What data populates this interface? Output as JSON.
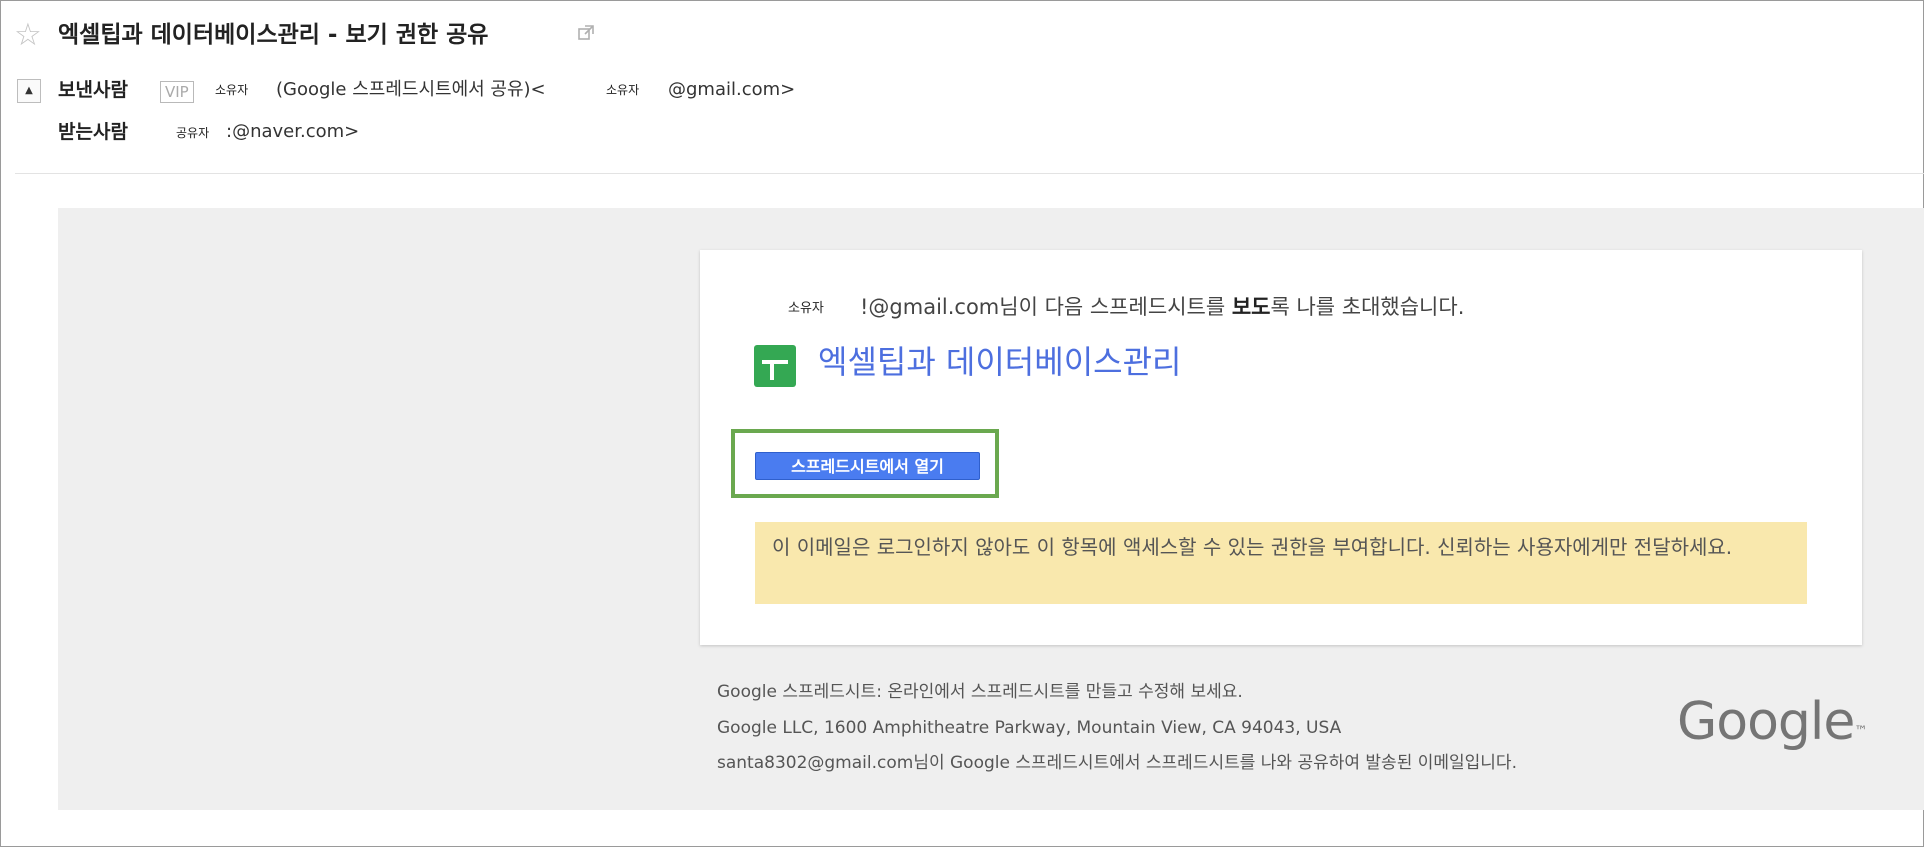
{
  "email": {
    "subject": "엑셀팁과 데이터베이스관리 - 보기 권한 공유",
    "from_label": "보낸사람",
    "vip_badge": "VIP",
    "from_owner_tag": "소유자",
    "from_sender_text": "(Google 스프레드시트에서 공유)<",
    "from_owner_tag_2": "소유자",
    "from_email_suffix": "@gmail.com>",
    "to_label": "받는사람",
    "to_share_tag": "공유자",
    "to_email_suffix": ":@naver.com>"
  },
  "body": {
    "owner_tag": "소유자",
    "invite_email": "!@gmail.com",
    "invite_text_1": "님이 다음 스프레드시트를 ",
    "invite_text_bold": "보도",
    "invite_text_2": "록 나를 초대했습니다.",
    "document_title": "엑셀팁과 데이터베이스관리",
    "open_button": "스프레드시트에서 열기",
    "warning": "이 이메일은 로그인하지 않아도 이 항목에 액세스할 수 있는 권한을 부여합니다. 신뢰하는 사용자에게만 전달하세요."
  },
  "footer": {
    "line1": "Google 스프레드시트: 온라인에서 스프레드시트를 만들고 수정해 보세요.",
    "line2": "Google LLC, 1600 Amphitheatre Parkway, Mountain View, CA 94043, USA",
    "line3": "santa8302@gmail.com님이 Google 스프레드시트에서 스프레드시트를 나와 공유하여 발송된 이메일입니다.",
    "logo": "Google",
    "logo_tm": "™"
  },
  "colors": {
    "link": "#4d6fdf",
    "button": "#4a7cf0",
    "highlight_border": "#6aa84f",
    "warning_bg": "#f9e8ad",
    "sheets_green": "#34a853"
  },
  "icons": [
    "star-icon",
    "external-link-icon",
    "collapse-arrow-icon",
    "google-sheets-icon"
  ]
}
